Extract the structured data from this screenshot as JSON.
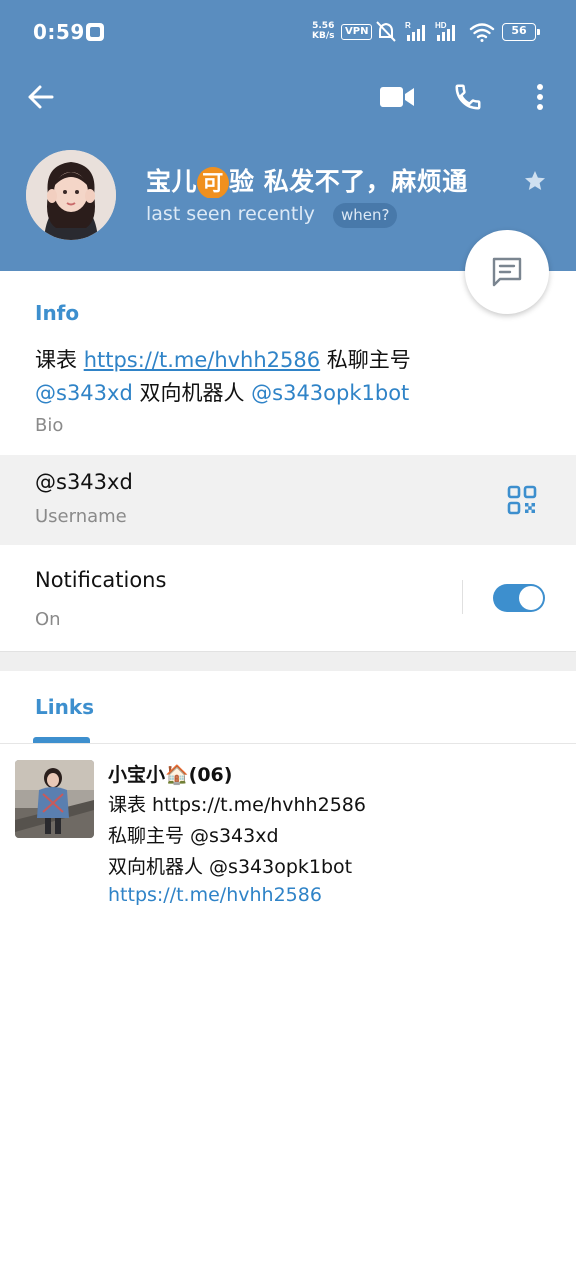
{
  "status_bar": {
    "time": "0:59",
    "speed_value": "5.56",
    "speed_unit": "KB/s",
    "vpn": "VPN",
    "signal_1_label": "R",
    "signal_2_label": "HD",
    "battery": "56"
  },
  "header": {
    "name": "宝儿可验 私发不了，麻烦通",
    "name_badge_char": "可",
    "last_seen": "last seen recently",
    "when_badge": "when?"
  },
  "info": {
    "title": "Info",
    "bio_1": "课表 ",
    "bio_link": "https://t.me/hvhh2586",
    "bio_2": " 私聊主号",
    "bio_mention_1": "@s343xd",
    "bio_3": " 双向机器人 ",
    "bio_mention_2": "@s343opk1bot",
    "bio_label": "Bio",
    "username": "@s343xd",
    "username_label": "Username",
    "notifications": "Notifications",
    "notifications_state": "On",
    "notifications_enabled": true
  },
  "links_tab": {
    "label": "Links"
  },
  "link_item": {
    "title": "小宝小🏠(06)",
    "desc_line_1": "课表  https://t.me/hvhh2586",
    "desc_line_2": "私聊主号 @s343xd",
    "desc_line_3": "双向机器人  @s343opk1bot",
    "url": "https://t.me/hvhh2586"
  },
  "colors": {
    "header_bg": "#5a8dbf",
    "accent": "#3d8fce",
    "link": "#2f83c7"
  }
}
